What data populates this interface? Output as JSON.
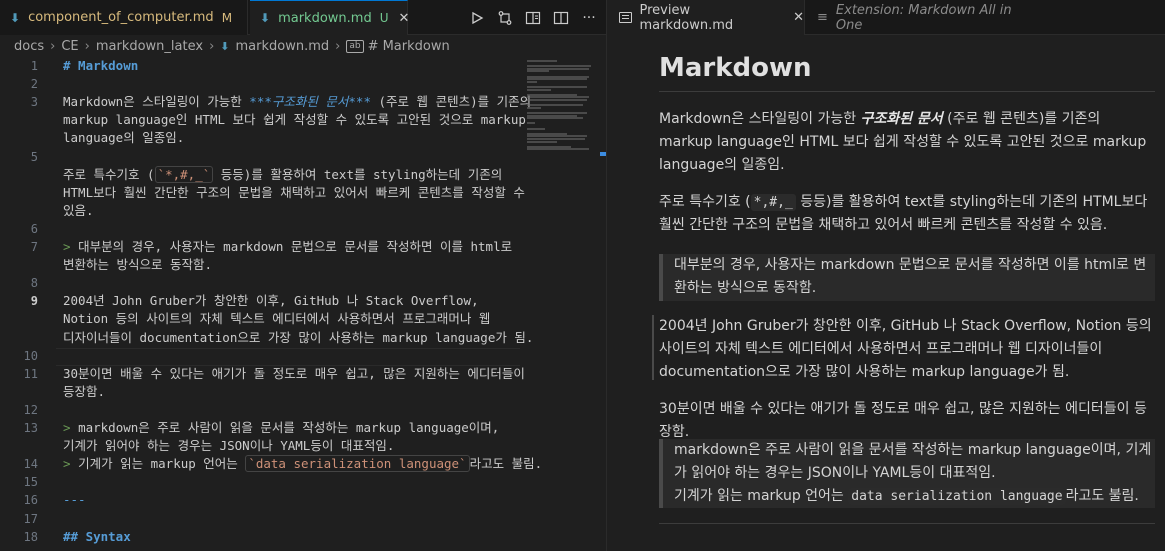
{
  "editor": {
    "tabs": [
      {
        "label": "component_of_computer.md",
        "badge": "M"
      },
      {
        "label": "markdown.md",
        "badge": "U",
        "close": "✕"
      }
    ],
    "breadcrumb": [
      "docs",
      "CE",
      "markdown_latex",
      "markdown.md",
      "# Markdown"
    ],
    "lines": [
      {
        "n": "1",
        "parts": [
          {
            "t": "# Markdown",
            "c": "heading"
          }
        ]
      },
      {
        "n": "2",
        "parts": []
      },
      {
        "n": "3",
        "parts": [
          {
            "t": "Markdown은 스타일링이 가능한 "
          },
          {
            "t": "***구조화된 문서***",
            "c": "emph"
          },
          {
            "t": " (주로 웹 콘텐츠)를 기존의"
          }
        ]
      },
      {
        "n": "",
        "parts": [
          {
            "t": "markup language인 HTML 보다 쉽게 작성할 수 있도록 고안된 것으로 markup"
          }
        ]
      },
      {
        "n": "",
        "parts": [
          {
            "t": "language의 일종임."
          }
        ]
      },
      {
        "n": "5",
        "parts": []
      },
      {
        "n": "",
        "parts": [
          {
            "t": "주로 특수기호 ("
          },
          {
            "t": "`*,#,_`",
            "c": "inlinecode"
          },
          {
            "t": " 등등)를 활용하여 text를 styling하는데 기존의"
          }
        ]
      },
      {
        "n": "",
        "parts": [
          {
            "t": "HTML보다 훨씬 간단한 구조의 문법을 채택하고 있어서 빠르케 콘텐츠를 작성할 수"
          }
        ]
      },
      {
        "n": "",
        "parts": [
          {
            "t": "있음."
          }
        ]
      },
      {
        "n": "6",
        "parts": []
      },
      {
        "n": "7",
        "parts": [
          {
            "t": "> ",
            "c": "quote"
          },
          {
            "t": "대부분의 경우, 사용자는 markdown 문법으로 문서를 작성하면 이를 html로"
          }
        ]
      },
      {
        "n": "",
        "parts": [
          {
            "t": "변환하는 방식으로 동작함."
          }
        ]
      },
      {
        "n": "8",
        "parts": []
      },
      {
        "n": "9",
        "active": true,
        "parts": [
          {
            "t": "2004년 John Gruber가 창안한 이후, GitHub 나 Stack Overflow,"
          }
        ]
      },
      {
        "n": "",
        "parts": [
          {
            "t": "Notion 등의 사이트의 자체 텍스트 에디터에서 사용하면서 프로그래머나 웹"
          }
        ]
      },
      {
        "n": "",
        "parts": [
          {
            "t": "디자이너들이 documentation으로 가장 많이 사용하는 markup language가 됨."
          }
        ]
      },
      {
        "n": "10",
        "parts": []
      },
      {
        "n": "11",
        "parts": [
          {
            "t": "30분이면 배울 수 있다는 애기가 돌 정도로 매우 쉽고, 많은 지원하는 에디터들이"
          }
        ]
      },
      {
        "n": "",
        "parts": [
          {
            "t": "등장함."
          }
        ]
      },
      {
        "n": "12",
        "parts": []
      },
      {
        "n": "13",
        "parts": [
          {
            "t": "> ",
            "c": "quote"
          },
          {
            "t": "markdown은 주로 사람이 읽을 문서를 작성하는 markup language이며,"
          }
        ]
      },
      {
        "n": "",
        "parts": [
          {
            "t": "기계가 읽어야 하는 경우는 JSON이나 YAML등이 대표적임."
          }
        ]
      },
      {
        "n": "14",
        "parts": [
          {
            "t": "> ",
            "c": "quote"
          },
          {
            "t": "기계가 읽는 markup 언어는 "
          },
          {
            "t": "`data serialization language`",
            "c": "inlinecode"
          },
          {
            "t": "라고도 불림."
          }
        ]
      },
      {
        "n": "15",
        "parts": []
      },
      {
        "n": "16",
        "parts": [
          {
            "t": "---",
            "c": "hr"
          }
        ]
      },
      {
        "n": "17",
        "parts": []
      },
      {
        "n": "18",
        "parts": [
          {
            "t": "## Syntax",
            "c": "heading"
          }
        ]
      }
    ]
  },
  "preview": {
    "tabs": [
      {
        "label": "Preview markdown.md",
        "close": "✕"
      },
      {
        "label": "Extension: Markdown All in One"
      }
    ],
    "title": "Markdown",
    "p1_a": "Markdown은 스타일링이 가능한 ",
    "p1_b": "구조화된 문서",
    "p1_c": " (주로 웹 콘텐츠)를 기존의 markup language인 HTML 보다 쉽게 작성할 수 있도록 고안된 것으로 markup language의 일종임.",
    "p2_a": "주로 특수기호 (",
    "p2_code": "*,#,_",
    "p2_b": " 등등)를 활용하여 text를 styling하는데 기존의 HTML보다 훨씬 간단한 구조의 문법을 채택하고 있어서 빠르케 콘텐츠를 작성할 수 있음.",
    "quote1": "대부분의 경우, 사용자는 markdown 문법으로 문서를 작성하면 이를 html로 변환하는 방식으로 동작함.",
    "p3": "2004년 John Gruber가 창안한 이후, GitHub 나 Stack Overflow, Notion 등의 사이트의 자체 텍스트 에디터에서 사용하면서 프로그래머나 웹 디자이너들이 documentation으로 가장 많이 사용하는 markup language가 됨.",
    "p4": "30분이면 배울 수 있다는 애기가 돌 정도로 매우 쉽고, 많은 지원하는 에디터들이 등장함.",
    "quote2_a": "markdown은 주로 사람이 읽을 문서를 작성하는 markup language이며, 기계가 읽어야 하는 경우는 JSON이나 YAML등이 대표적임.",
    "quote2_b": "기계가 읽는 markup 언어는 ",
    "quote2_code": "data serialization language",
    "quote2_c": "라고도 불림."
  }
}
